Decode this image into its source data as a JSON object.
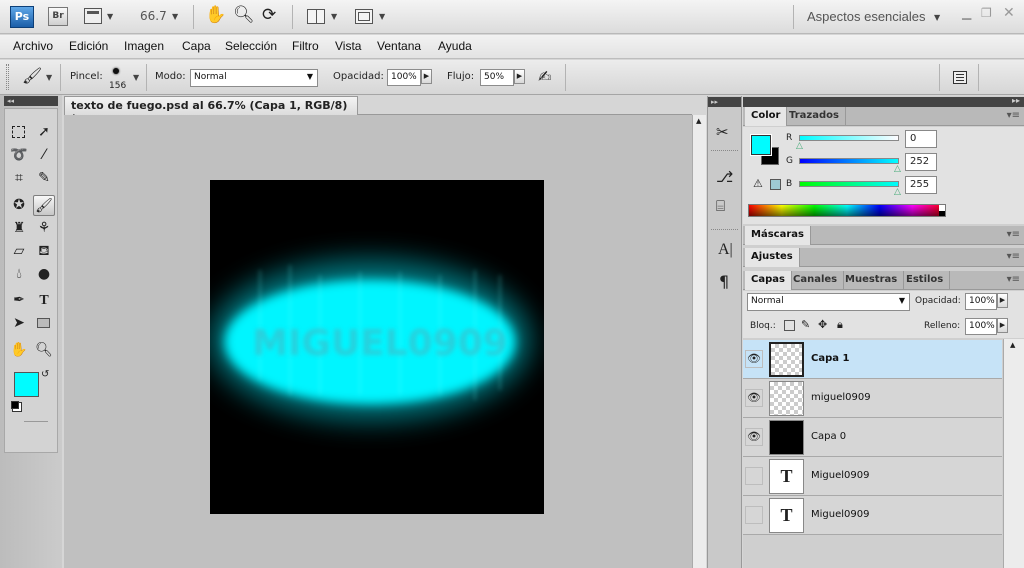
{
  "appbar": {
    "logo": "Ps",
    "bridge": "Br",
    "zoom": "66.7",
    "workspace": "Aspectos esenciales"
  },
  "menu": [
    "Archivo",
    "Edición",
    "Imagen",
    "Capa",
    "Selección",
    "Filtro",
    "Vista",
    "Ventana",
    "Ayuda"
  ],
  "options": {
    "brush_label": "Pincel:",
    "brush_size": "156",
    "mode_label": "Modo:",
    "mode_value": "Normal",
    "opacity_label": "Opacidad:",
    "opacity_value": "100%",
    "flow_label": "Flujo:",
    "flow_value": "50%"
  },
  "document": {
    "tab_title": "texto de fuego.psd al 66.7% (Capa 1, RGB/8) *",
    "close": "×",
    "canvas_text": "MIGUEL0909"
  },
  "color_panel": {
    "tabs": [
      "Color",
      "Trazados"
    ],
    "r_label": "R",
    "r_value": "0",
    "g_label": "G",
    "g_value": "252",
    "b_label": "B",
    "b_value": "255",
    "foreground": "#00fcff",
    "background": "#000000"
  },
  "masks_panel": {
    "title": "Máscaras"
  },
  "adjust_panel": {
    "title": "Ajustes"
  },
  "layers_panel": {
    "tabs": [
      "Capas",
      "Canales",
      "Muestras",
      "Estilos"
    ],
    "blend_mode": "Normal",
    "opacity_label": "Opacidad:",
    "opacity_value": "100%",
    "lock_label": "Bloq.:",
    "fill_label": "Relleno:",
    "fill_value": "100%",
    "layers": [
      {
        "name": "Capa 1",
        "visible": true,
        "selected": true
      },
      {
        "name": "miguel0909",
        "visible": true,
        "selected": false
      },
      {
        "name": "Capa 0",
        "visible": true,
        "selected": false
      },
      {
        "name": "Miguel0909",
        "visible": false,
        "selected": false
      },
      {
        "name": "Miguel0909",
        "visible": false,
        "selected": false
      }
    ],
    "text_thumb": "T"
  },
  "colors": {
    "accent": "#00fcff",
    "selected_row": "#c6e3f7"
  }
}
